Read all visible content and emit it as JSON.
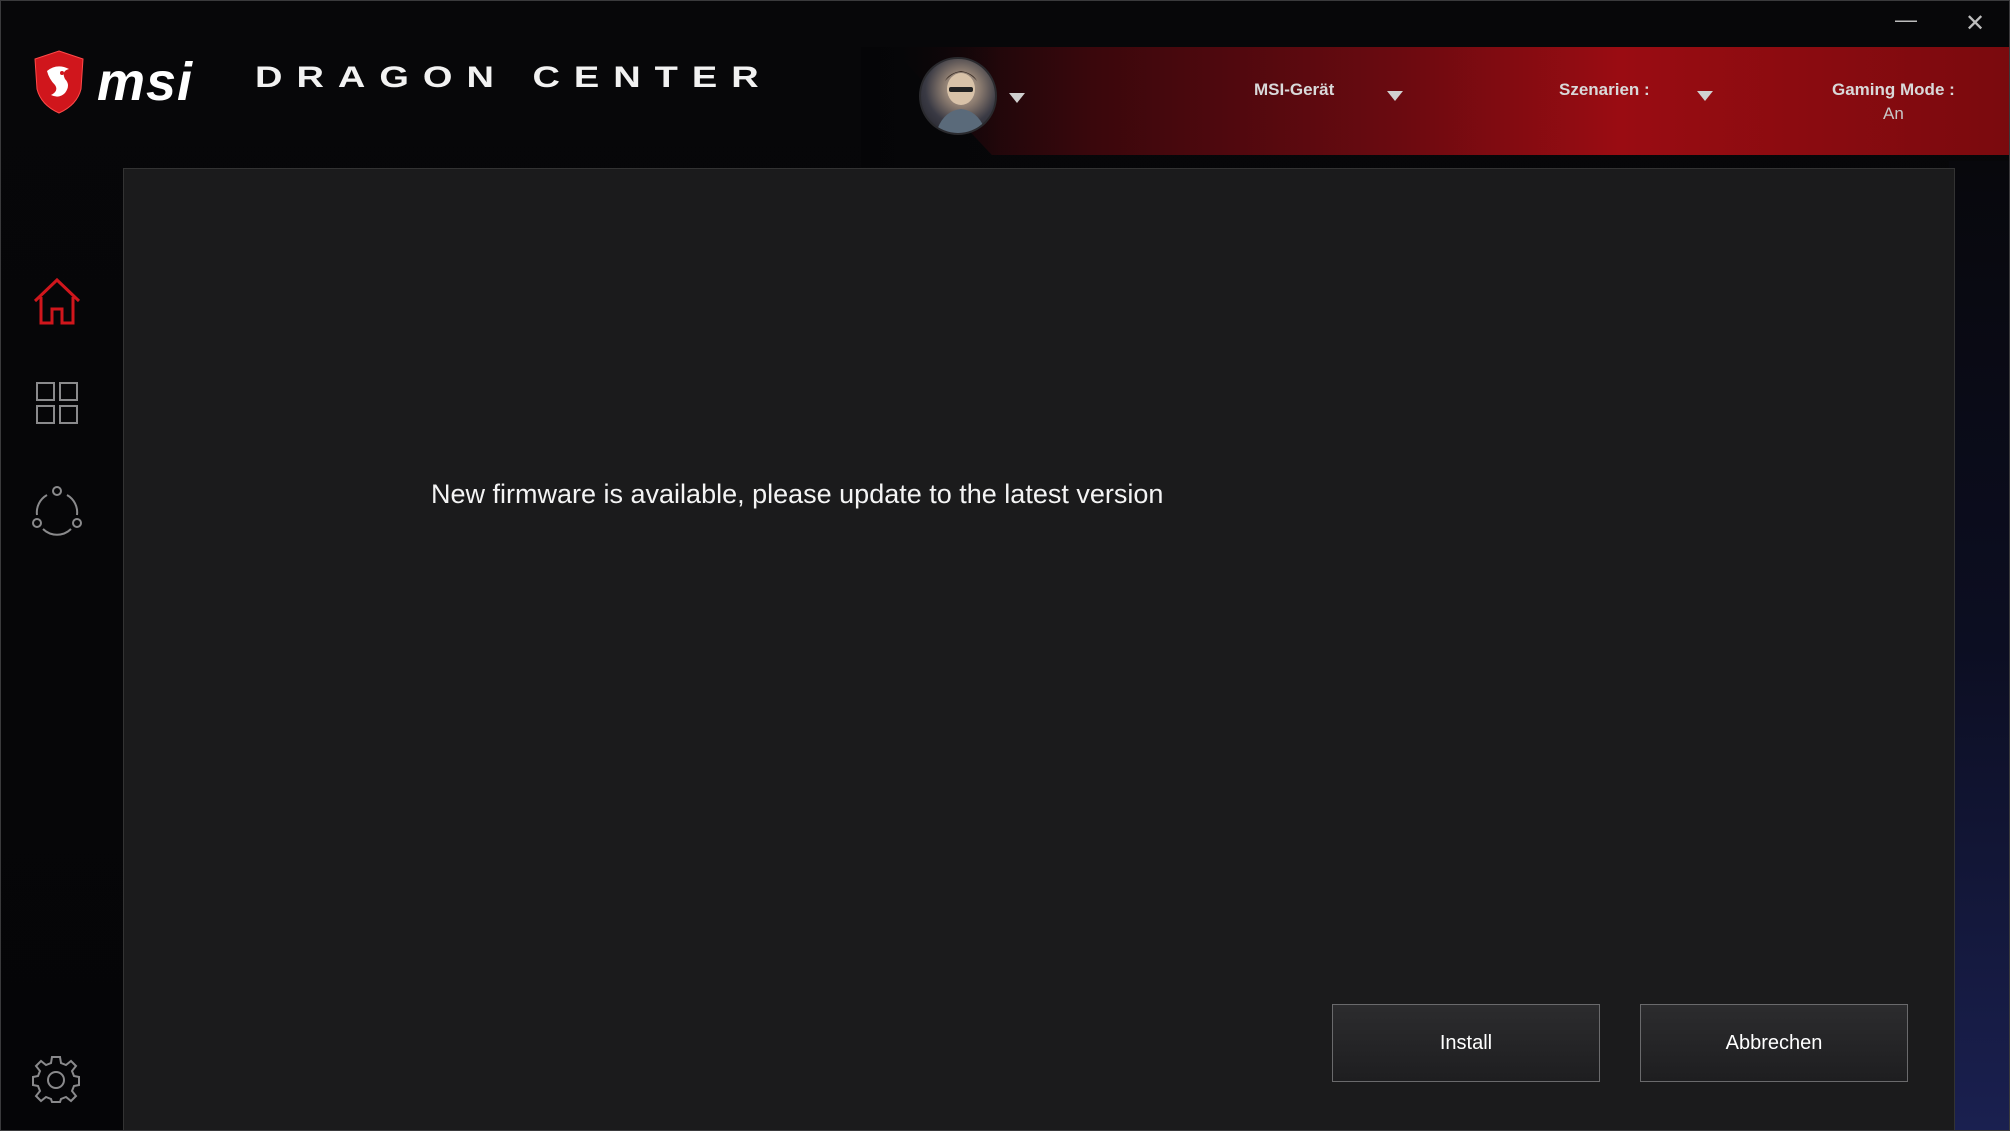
{
  "header": {
    "brand": "msi",
    "app_title": "DRAGON CENTER",
    "device_label": "MSI-Gerät",
    "scenarios_label": "Szenarien :",
    "gaming_mode_label": "Gaming Mode :",
    "gaming_mode_value": "An"
  },
  "window_controls": {
    "minimize": "—",
    "close": "✕"
  },
  "sidebar": {
    "items": [
      {
        "icon": "home-icon",
        "active": true
      },
      {
        "icon": "apps-grid-icon",
        "active": false
      },
      {
        "icon": "network-icon",
        "active": false
      }
    ],
    "settings_icon": "gear-icon"
  },
  "dialog": {
    "message": "New firmware is available, please update to the latest version",
    "install_label": "Install",
    "cancel_label": "Abbrechen"
  },
  "colors": {
    "accent_red": "#d0161c",
    "panel_bg": "#1b1b1c",
    "window_bg": "#050507"
  }
}
